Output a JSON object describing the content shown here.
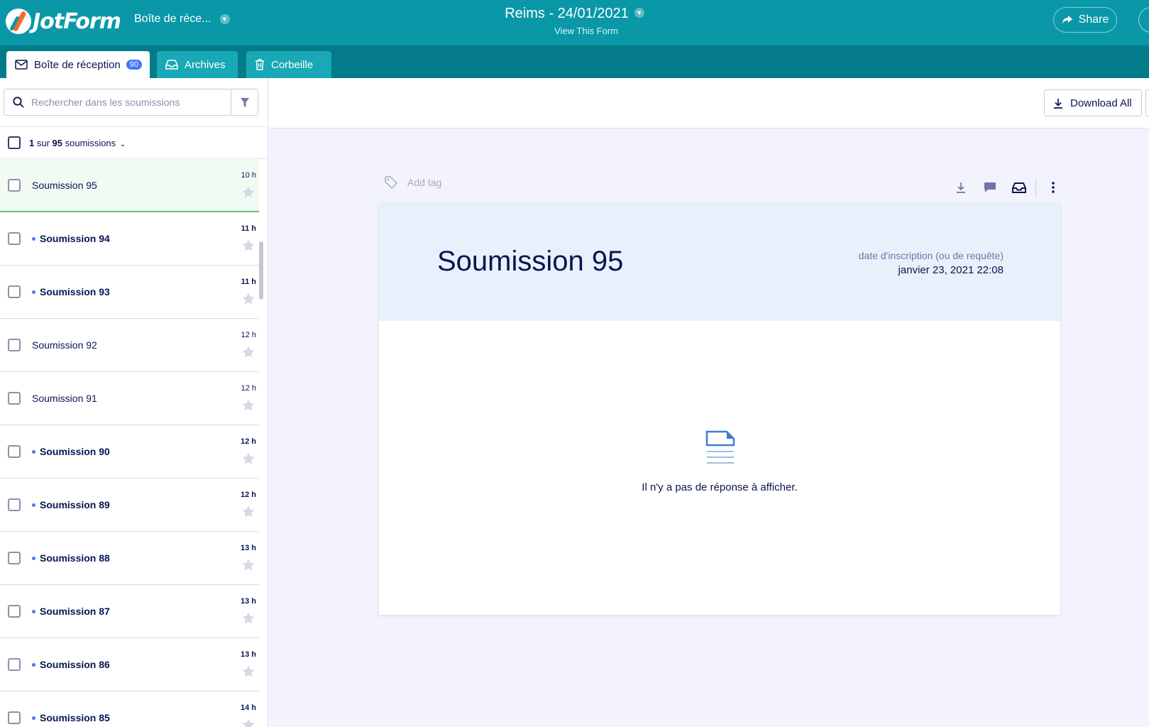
{
  "header": {
    "logo_text": "JotForm",
    "form_switcher": "Boîte de réce...",
    "form_title": "Reims - 24/01/2021",
    "view_form": "View This Form",
    "share": "Share"
  },
  "tabs": [
    {
      "label": "Boîte de réception",
      "badge": "90",
      "icon": "envelope-icon",
      "active": true
    },
    {
      "label": "Archives",
      "icon": "inbox-tray-icon",
      "active": false
    },
    {
      "label": "Corbeille",
      "icon": "trash-icon",
      "active": false
    }
  ],
  "sidebar": {
    "search_placeholder": "Rechercher dans les soumissions",
    "count_current": "1",
    "count_sep": "sur",
    "count_total": "95",
    "count_word": "soumissions",
    "submissions": [
      {
        "name": "Soumission 95",
        "time": "10 h",
        "unread": false,
        "selected": true
      },
      {
        "name": "Soumission 94",
        "time": "11 h",
        "unread": true
      },
      {
        "name": "Soumission 93",
        "time": "11 h",
        "unread": true
      },
      {
        "name": "Soumission 92",
        "time": "12 h",
        "unread": false
      },
      {
        "name": "Soumission 91",
        "time": "12 h",
        "unread": false
      },
      {
        "name": "Soumission 90",
        "time": "12 h",
        "unread": true
      },
      {
        "name": "Soumission 89",
        "time": "12 h",
        "unread": true
      },
      {
        "name": "Soumission 88",
        "time": "13 h",
        "unread": true
      },
      {
        "name": "Soumission 87",
        "time": "13 h",
        "unread": true
      },
      {
        "name": "Soumission 86",
        "time": "13 h",
        "unread": true
      },
      {
        "name": "Soumission 85",
        "time": "14 h",
        "unread": true
      }
    ]
  },
  "toolbar": {
    "download_all": "Download All"
  },
  "detail": {
    "add_tag": "Add tag",
    "title": "Soumission 95",
    "date_label": "date d'inscription (ou de requête)",
    "date_value": "janvier 23, 2021 22:08",
    "empty_message": "Il n'y a pas de réponse à afficher."
  },
  "colors": {
    "header": "#0a98a8",
    "tabbar": "#047b88",
    "badge": "#4277ff",
    "selected_row": "#f1fbf3"
  }
}
